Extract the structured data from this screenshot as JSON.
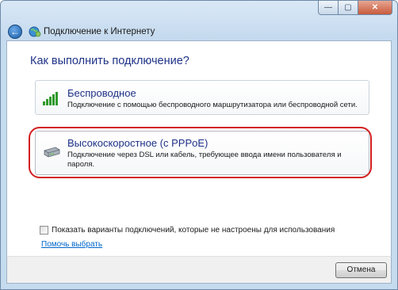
{
  "window": {
    "title": "Подключение к Интернету",
    "caption_buttons": {
      "minimize": "—",
      "maximize": "▢",
      "close": "✕"
    }
  },
  "nav": {
    "back_symbol": "←"
  },
  "content": {
    "heading": "Как выполнить подключение?",
    "options": [
      {
        "title": "Беспроводное",
        "description": "Подключение с помощью беспроводного маршрутизатора или беспроводной сети.",
        "icon": "signal-bars-icon"
      },
      {
        "title": "Высокоскоростное (с PPPoE)",
        "description": "Подключение через DSL или кабель, требующее ввода имени пользователя и пароля.",
        "icon": "modem-icon",
        "highlighted": true
      }
    ],
    "show_unconfigured_label": "Показать варианты подключений, которые не настроены для использования",
    "show_unconfigured_checked": false,
    "help_link": "Помочь выбрать"
  },
  "footer": {
    "cancel_label": "Отмена"
  },
  "colors": {
    "heading": "#1e3287",
    "link": "#0066cc",
    "highlight_ring": "#d21f1f",
    "frame": "#c5dbee"
  }
}
